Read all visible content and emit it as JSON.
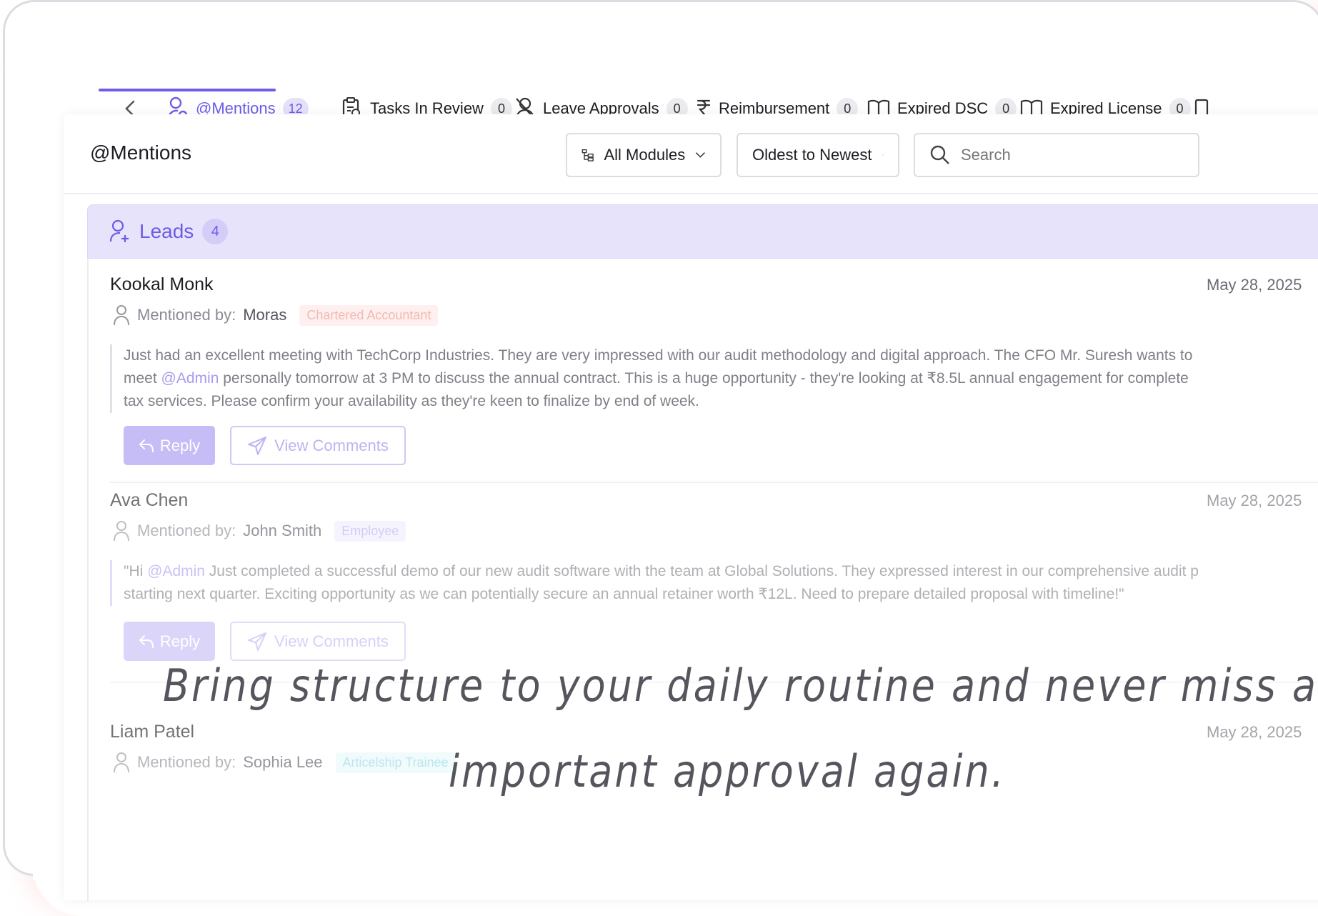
{
  "tabs": [
    {
      "label": "@Mentions",
      "count": "12",
      "icon": "user-mention-icon"
    },
    {
      "label": "Tasks In Review",
      "count": "0",
      "icon": "clipboard-search-icon"
    },
    {
      "label": "Leave Approvals",
      "count": "0",
      "icon": "user-off-icon"
    },
    {
      "label": "Reimbursement",
      "count": "0",
      "icon": "rupee-icon"
    },
    {
      "label": "Expired DSC",
      "count": "0",
      "icon": "book-icon"
    },
    {
      "label": "Expired License",
      "count": "0",
      "icon": "book-icon"
    }
  ],
  "panel": {
    "title": "@Mentions",
    "module_filter": "All Modules",
    "sort": "Oldest to Newest",
    "search_placeholder": "Search"
  },
  "section": {
    "label": "Leads",
    "count": "4"
  },
  "mentioned_by_label": "Mentioned by:",
  "items": [
    {
      "name": "Kookal Monk",
      "date": "May 28, 2025",
      "by": "Moras",
      "role": "Chartered Accountant",
      "message_lines": [
        [
          "Just had an excellent meeting with TechCorp Industries. They are very impressed with our audit methodology and digital approach. The CFO Mr. Suresh wants to"
        ],
        [
          "meet ",
          "@Admin",
          " personally tomorrow at 3 PM to discuss the annual contract. This is a huge opportunity - they're looking at ₹8.5L annual engagement for complete"
        ],
        [
          "tax services. Please confirm your availability as they're keen to finalize by end of week."
        ]
      ]
    },
    {
      "name": "Ava Chen",
      "date": "May 28, 2025",
      "by": "John Smith",
      "role": "Employee",
      "message_lines": [
        [
          "\"Hi ",
          "@Admin",
          " Just completed a successful demo of our new audit software with the team at Global Solutions. They expressed interest in our comprehensive audit p"
        ],
        [
          "starting next quarter. Exciting opportunity as we can potentially secure an annual retainer worth ₹12L. Need to prepare detailed proposal with timeline!\""
        ]
      ]
    },
    {
      "name": "Liam Patel",
      "date": "May 28, 2025",
      "by": "Sophia Lee",
      "role": "Articelship Trainee"
    }
  ],
  "buttons": {
    "reply": "Reply",
    "view_comments": "View Comments"
  },
  "tagline": {
    "line1": "Bring structure to your daily routine and never miss an",
    "line2": "important approval again."
  },
  "colors": {
    "accent": "#6c5ce7",
    "section_bg": "#e6e3fb"
  }
}
